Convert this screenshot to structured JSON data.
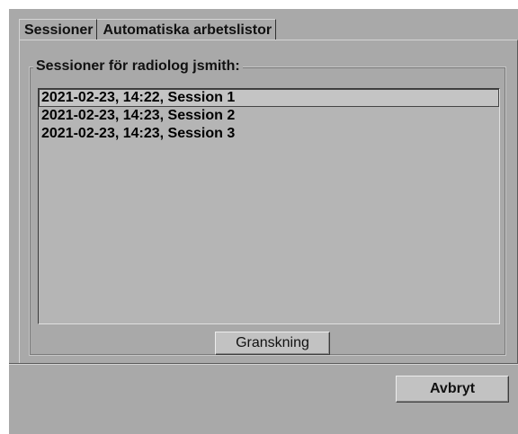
{
  "tabs": [
    {
      "label": "Sessioner",
      "active": true
    },
    {
      "label": "Automatiska arbetslistor",
      "active": false
    }
  ],
  "group": {
    "title": "Sessioner för radiolog jsmith:"
  },
  "sessions": [
    {
      "label": "2021-02-23, 14:22, Session 1",
      "selected": true
    },
    {
      "label": "2021-02-23, 14:23, Session 2",
      "selected": false
    },
    {
      "label": "2021-02-23, 14:23, Session 3",
      "selected": false
    }
  ],
  "buttons": {
    "review_label": "Granskning",
    "cancel_label": "Avbryt"
  },
  "colors": {
    "dialog_background": "#a9a9a9",
    "list_background": "#b5b5b5",
    "button_face": "#c2c2c2"
  }
}
